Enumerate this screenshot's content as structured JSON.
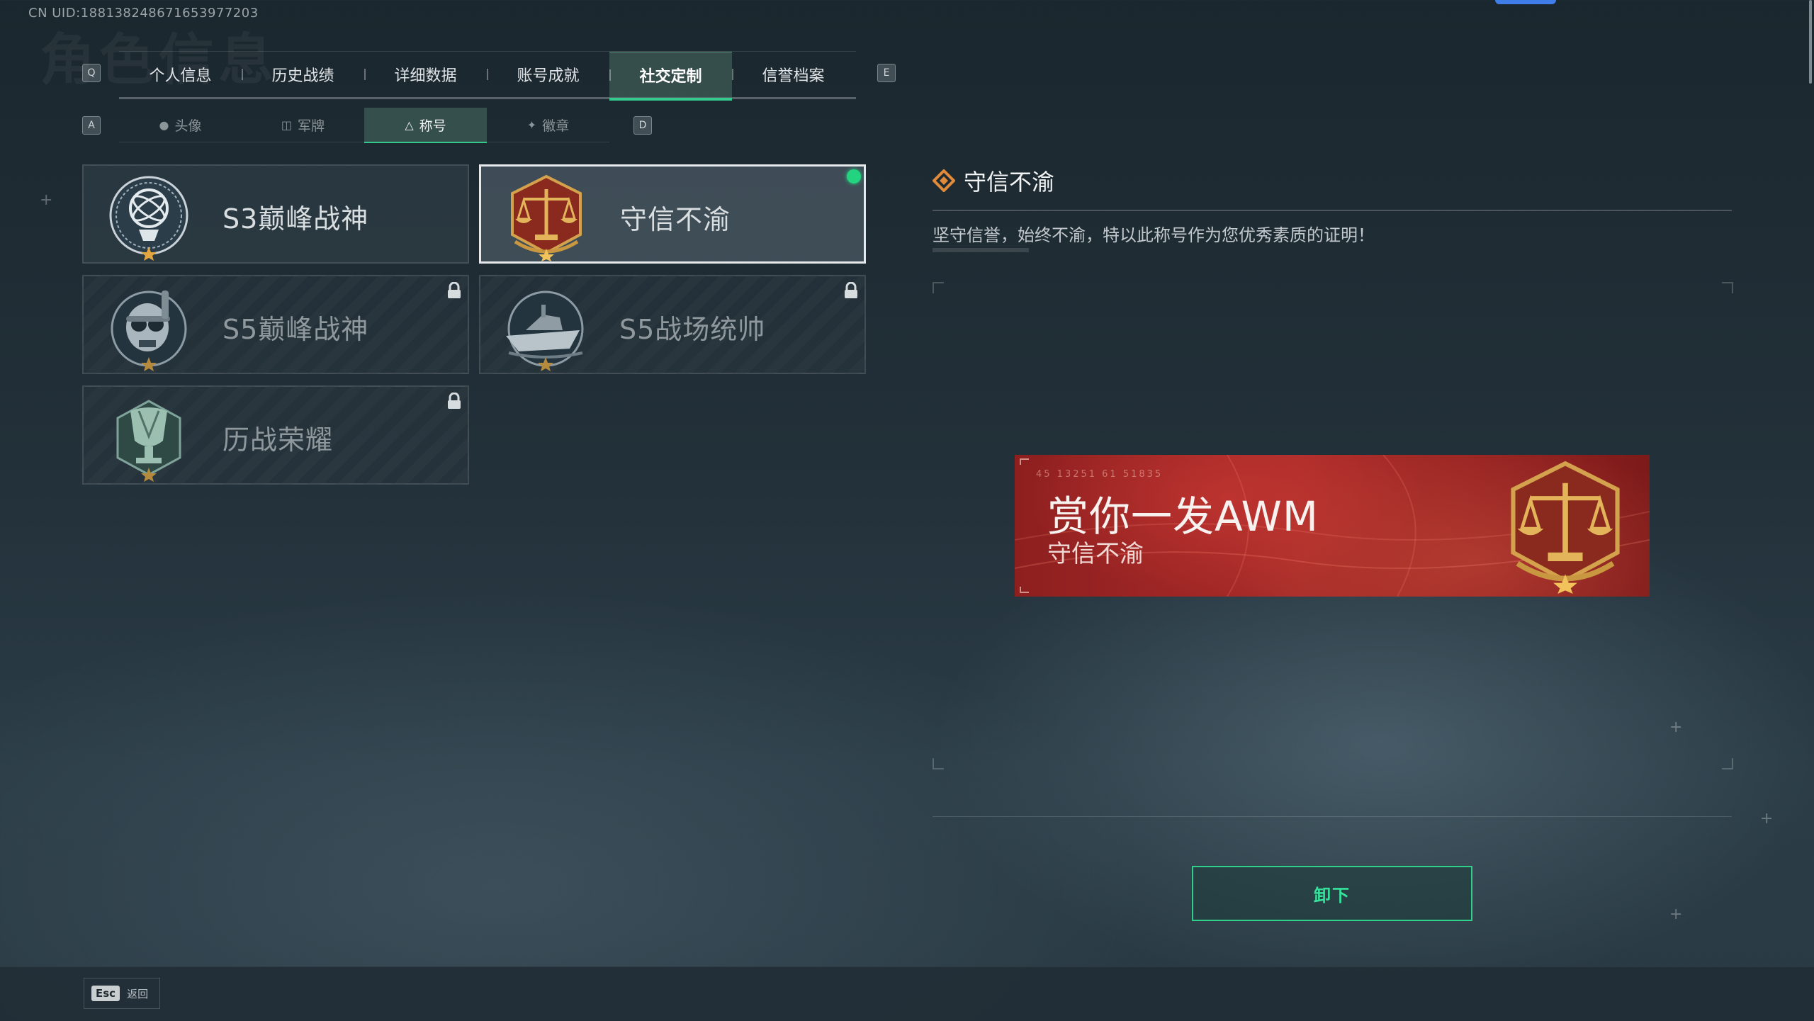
{
  "uid_text": "CN UID:188138248671653977203",
  "ghost_title": "角色信息",
  "colors": {
    "accent": "#34c98d",
    "equipped": "#23d37f",
    "banner_red": "#a92c29",
    "gold": "#d4a24c"
  },
  "main_tabs": {
    "prev_key": "Q",
    "next_key": "E",
    "items": [
      {
        "label": "个人信息"
      },
      {
        "label": "历史战绩"
      },
      {
        "label": "详细数据"
      },
      {
        "label": "账号成就"
      },
      {
        "label": "社交定制",
        "active": true
      },
      {
        "label": "信誉档案"
      }
    ]
  },
  "sub_tabs": {
    "prev_key": "A",
    "next_key": "D",
    "items": [
      {
        "label": "头像",
        "icon": "person-icon"
      },
      {
        "label": "军牌",
        "icon": "dogtag-icon"
      },
      {
        "label": "称号",
        "icon": "title-icon",
        "active": true
      },
      {
        "label": "徽章",
        "icon": "badge-icon"
      }
    ]
  },
  "titles": [
    {
      "label": "S3巅峰战神",
      "emblem": "gyroscope-emblem-icon",
      "locked": false,
      "selected": false
    },
    {
      "label": "守信不渝",
      "emblem": "scales-emblem-icon",
      "locked": false,
      "selected": true,
      "equipped": true
    },
    {
      "label": "S5巅峰战神",
      "emblem": "skull-emblem-icon",
      "locked": true,
      "selected": false
    },
    {
      "label": "S5战场统帅",
      "emblem": "boat-emblem-icon",
      "locked": true,
      "selected": false
    },
    {
      "label": "历战荣耀",
      "emblem": "trophy-emblem-icon",
      "locked": true,
      "selected": false
    }
  ],
  "detail": {
    "title": "守信不渝",
    "description": "坚守信誉，始终不渝，特以此称号作为您优秀素质的证明！"
  },
  "banner": {
    "code": "45 13251  61 51835",
    "player_name": "赏你一发AWM",
    "title": "守信不渝"
  },
  "actions": {
    "unequip_label": "卸下"
  },
  "footer": {
    "esc_key": "Esc",
    "back_label": "返回"
  }
}
